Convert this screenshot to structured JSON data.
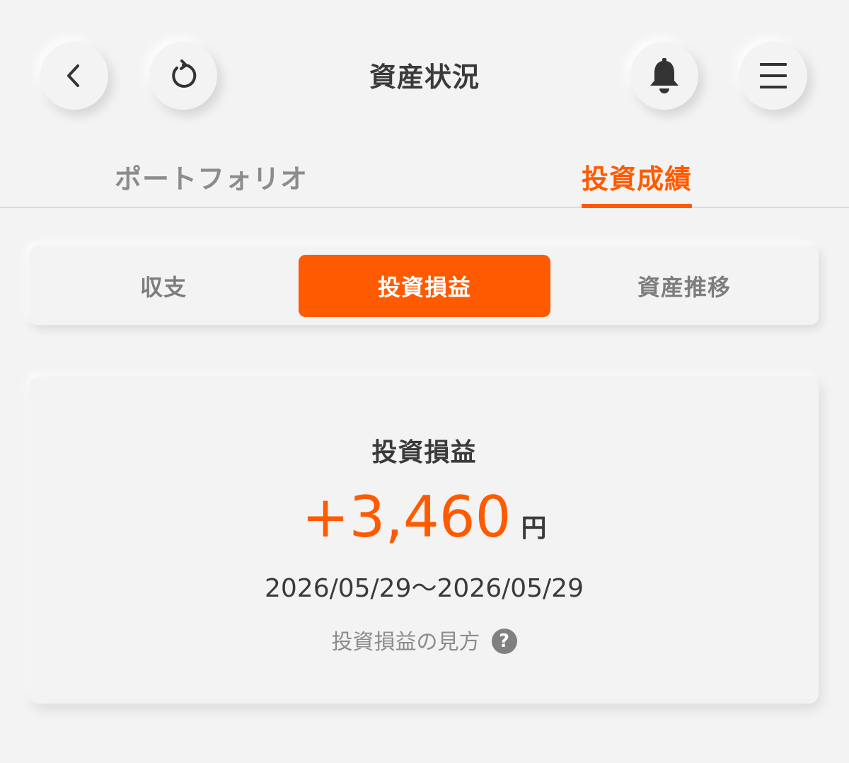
{
  "header": {
    "title": "資産状況",
    "icons": {
      "back": "chevron-left-icon",
      "refresh": "refresh-icon",
      "notifications": "bell-icon",
      "menu": "hamburger-menu-icon"
    }
  },
  "top_tabs": [
    {
      "label": "ポートフォリオ",
      "active": false
    },
    {
      "label": "投資成績",
      "active": true
    }
  ],
  "segment": [
    {
      "label": "収支",
      "active": false
    },
    {
      "label": "投資損益",
      "active": true
    },
    {
      "label": "資産推移",
      "active": false
    }
  ],
  "card": {
    "title": "投資損益",
    "amount": "+3,460",
    "unit": "円",
    "date_range": "2026/05/29〜2026/05/29",
    "help_label": "投資損益の見方",
    "help_icon": "?"
  },
  "colors": {
    "accent": "#ff5a00",
    "background": "#f3f3f3",
    "text": "#3a3a3a",
    "muted": "#8c8c8c"
  }
}
